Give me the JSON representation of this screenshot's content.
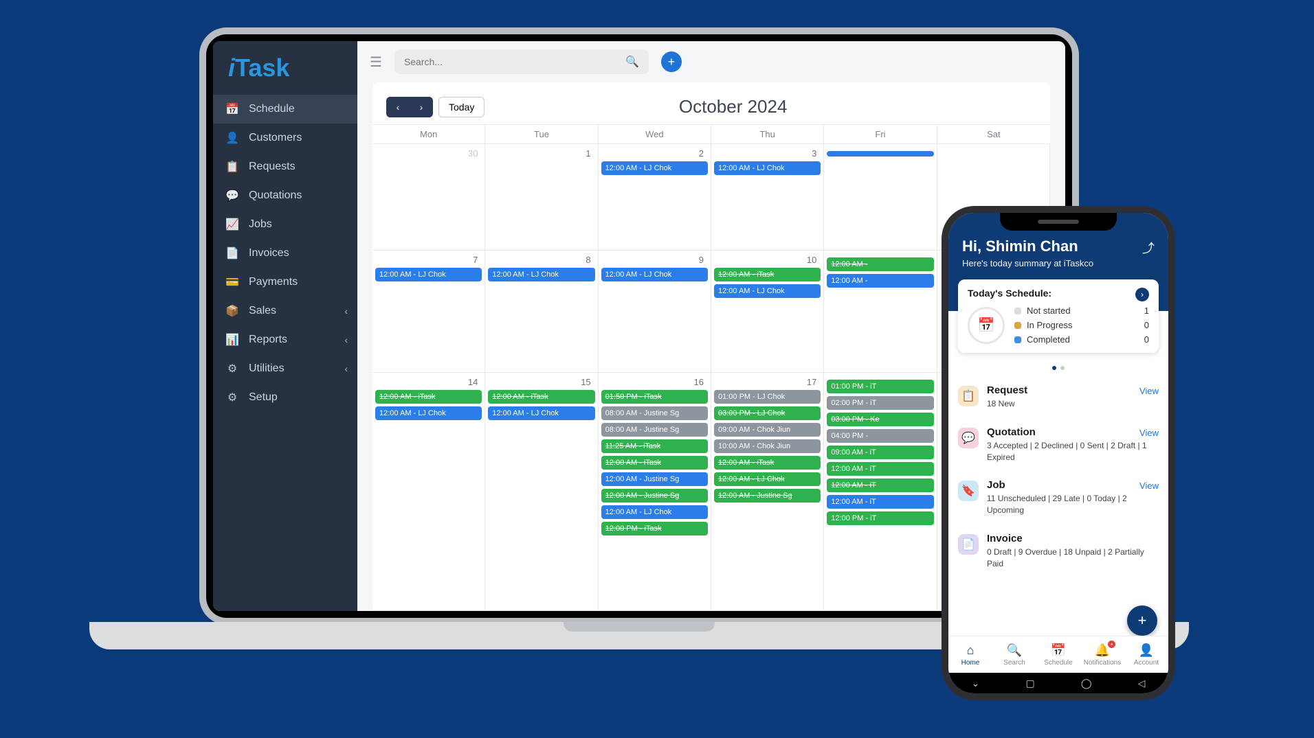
{
  "app": {
    "name": "iTask"
  },
  "sidebar": {
    "items": [
      {
        "icon": "📅",
        "label": "Schedule",
        "active": true,
        "sub": false
      },
      {
        "icon": "👤",
        "label": "Customers",
        "active": false,
        "sub": false
      },
      {
        "icon": "📋",
        "label": "Requests",
        "active": false,
        "sub": false
      },
      {
        "icon": "💬",
        "label": "Quotations",
        "active": false,
        "sub": false
      },
      {
        "icon": "📈",
        "label": "Jobs",
        "active": false,
        "sub": false
      },
      {
        "icon": "📄",
        "label": "Invoices",
        "active": false,
        "sub": false
      },
      {
        "icon": "💳",
        "label": "Payments",
        "active": false,
        "sub": false
      },
      {
        "icon": "📦",
        "label": "Sales",
        "active": false,
        "sub": true
      },
      {
        "icon": "📊",
        "label": "Reports",
        "active": false,
        "sub": true
      },
      {
        "icon": "⚙",
        "label": "Utilities",
        "active": false,
        "sub": true
      },
      {
        "icon": "⚙",
        "label": "Setup",
        "active": false,
        "sub": false
      }
    ]
  },
  "topbar": {
    "search_placeholder": "Search..."
  },
  "calendar": {
    "today_label": "Today",
    "title": "October 2024",
    "weekdays": [
      "Mon",
      "Tue",
      "Wed",
      "Thu",
      "Fri",
      "Sat"
    ],
    "weeks": [
      [
        {
          "n": "30",
          "muted": true,
          "events": []
        },
        {
          "n": "1",
          "events": []
        },
        {
          "n": "2",
          "events": [
            {
              "c": "blue",
              "t": "12:00 AM - LJ Chok"
            }
          ]
        },
        {
          "n": "3",
          "events": [
            {
              "c": "blue",
              "t": "12:00 AM - LJ Chok"
            }
          ]
        },
        {
          "n": "",
          "events": [
            {
              "c": "blue",
              "t": ""
            }
          ]
        },
        {
          "n": "",
          "events": []
        }
      ],
      [
        {
          "n": "7",
          "events": [
            {
              "c": "blue",
              "t": "12:00 AM - LJ Chok"
            }
          ]
        },
        {
          "n": "8",
          "events": [
            {
              "c": "blue",
              "t": "12:00 AM - LJ Chok"
            }
          ]
        },
        {
          "n": "9",
          "events": [
            {
              "c": "blue",
              "t": "12:00 AM - LJ Chok"
            }
          ]
        },
        {
          "n": "10",
          "events": [
            {
              "c": "green",
              "t": "12:00 AM - iTask",
              "s": true
            },
            {
              "c": "blue",
              "t": "12:00 AM - LJ Chok"
            }
          ]
        },
        {
          "n": "",
          "events": [
            {
              "c": "green",
              "t": "12:00 AM -",
              "s": true
            },
            {
              "c": "blue",
              "t": "12:00 AM -"
            }
          ]
        },
        {
          "n": "",
          "events": []
        }
      ],
      [
        {
          "n": "14",
          "events": [
            {
              "c": "green",
              "t": "12:00 AM - iTask",
              "s": true
            },
            {
              "c": "blue",
              "t": "12:00 AM - LJ Chok"
            }
          ]
        },
        {
          "n": "15",
          "events": [
            {
              "c": "green",
              "t": "12:00 AM - iTask",
              "s": true
            },
            {
              "c": "blue",
              "t": "12:00 AM - LJ Chok"
            }
          ]
        },
        {
          "n": "16",
          "events": [
            {
              "c": "green",
              "t": "01:50 PM - iTask",
              "s": true
            },
            {
              "c": "grey",
              "t": "08:00 AM - Justine Sg"
            },
            {
              "c": "grey",
              "t": "08:00 AM - Justine Sg"
            },
            {
              "c": "green",
              "t": "11:25 AM - iTask",
              "s": true
            },
            {
              "c": "green",
              "t": "12:00 AM - iTask",
              "s": true
            },
            {
              "c": "blue",
              "t": "12:00 AM - Justine Sg"
            },
            {
              "c": "green",
              "t": "12:00 AM - Justine Sg",
              "s": true
            },
            {
              "c": "blue",
              "t": "12:00 AM - LJ Chok"
            },
            {
              "c": "green",
              "t": "12:00 PM - iTask",
              "s": true
            }
          ]
        },
        {
          "n": "17",
          "events": [
            {
              "c": "grey",
              "t": "01:00 PM - LJ Chok"
            },
            {
              "c": "green",
              "t": "03:00 PM - LJ Chok",
              "s": true
            },
            {
              "c": "grey",
              "t": "09:00 AM - Chok Jiun"
            },
            {
              "c": "grey",
              "t": "10:00 AM - Chok Jiun"
            },
            {
              "c": "green",
              "t": "12:00 AM - iTask",
              "s": true
            },
            {
              "c": "green",
              "t": "12:00 AM - LJ Chok",
              "s": true
            },
            {
              "c": "green",
              "t": "12:00 AM - Justine Sg",
              "s": true
            }
          ]
        },
        {
          "n": "",
          "events": [
            {
              "c": "green",
              "t": "01:00 PM - iT"
            },
            {
              "c": "grey",
              "t": "02:00 PM - iT"
            },
            {
              "c": "green",
              "t": "03:00 PM - Ke",
              "s": true
            },
            {
              "c": "grey",
              "t": "04:00 PM -"
            },
            {
              "c": "green",
              "t": "09:00 AM - iT"
            },
            {
              "c": "green",
              "t": "12:00 AM - iT"
            },
            {
              "c": "green",
              "t": "12:00 AM - iT",
              "s": true
            },
            {
              "c": "blue",
              "t": "12:00 AM - iT"
            },
            {
              "c": "green",
              "t": "12:00 PM - iT"
            }
          ]
        },
        {
          "n": "",
          "events": []
        }
      ]
    ]
  },
  "phone": {
    "greeting": "Hi, Shimin Chan",
    "subtitle": "Here's today summary at iTaskco",
    "schedule": {
      "title": "Today's Schedule:",
      "rows": [
        {
          "label": "Not started",
          "count": 1,
          "cls": "ns"
        },
        {
          "label": "In Progress",
          "count": 0,
          "cls": "ip"
        },
        {
          "label": "Completed",
          "count": 0,
          "cls": "cp"
        }
      ]
    },
    "sections": [
      {
        "icon": "ic-req",
        "sym": "📋",
        "title": "Request",
        "view": "View",
        "meta": "18 New"
      },
      {
        "icon": "ic-quo",
        "sym": "💬",
        "title": "Quotation",
        "view": "View",
        "meta": "3 Accepted  |  2 Declined  |  0 Sent  |  2 Draft  |  1 Expired"
      },
      {
        "icon": "ic-job",
        "sym": "🔖",
        "title": "Job",
        "view": "View",
        "meta": "11 Unscheduled  |  29 Late  |  0 Today  |  2 Upcoming"
      },
      {
        "icon": "ic-inv",
        "sym": "📄",
        "title": "Invoice",
        "view": "",
        "meta": "0 Draft  |  9 Overdue  |  18 Unpaid  |  2 Partially Paid"
      }
    ],
    "tabs": [
      {
        "icon": "⌂",
        "label": "Home",
        "active": true
      },
      {
        "icon": "🔍",
        "label": "Search"
      },
      {
        "icon": "📅",
        "label": "Schedule"
      },
      {
        "icon": "🔔",
        "label": "Notifications",
        "badge": "•"
      },
      {
        "icon": "👤",
        "label": "Account"
      }
    ]
  }
}
